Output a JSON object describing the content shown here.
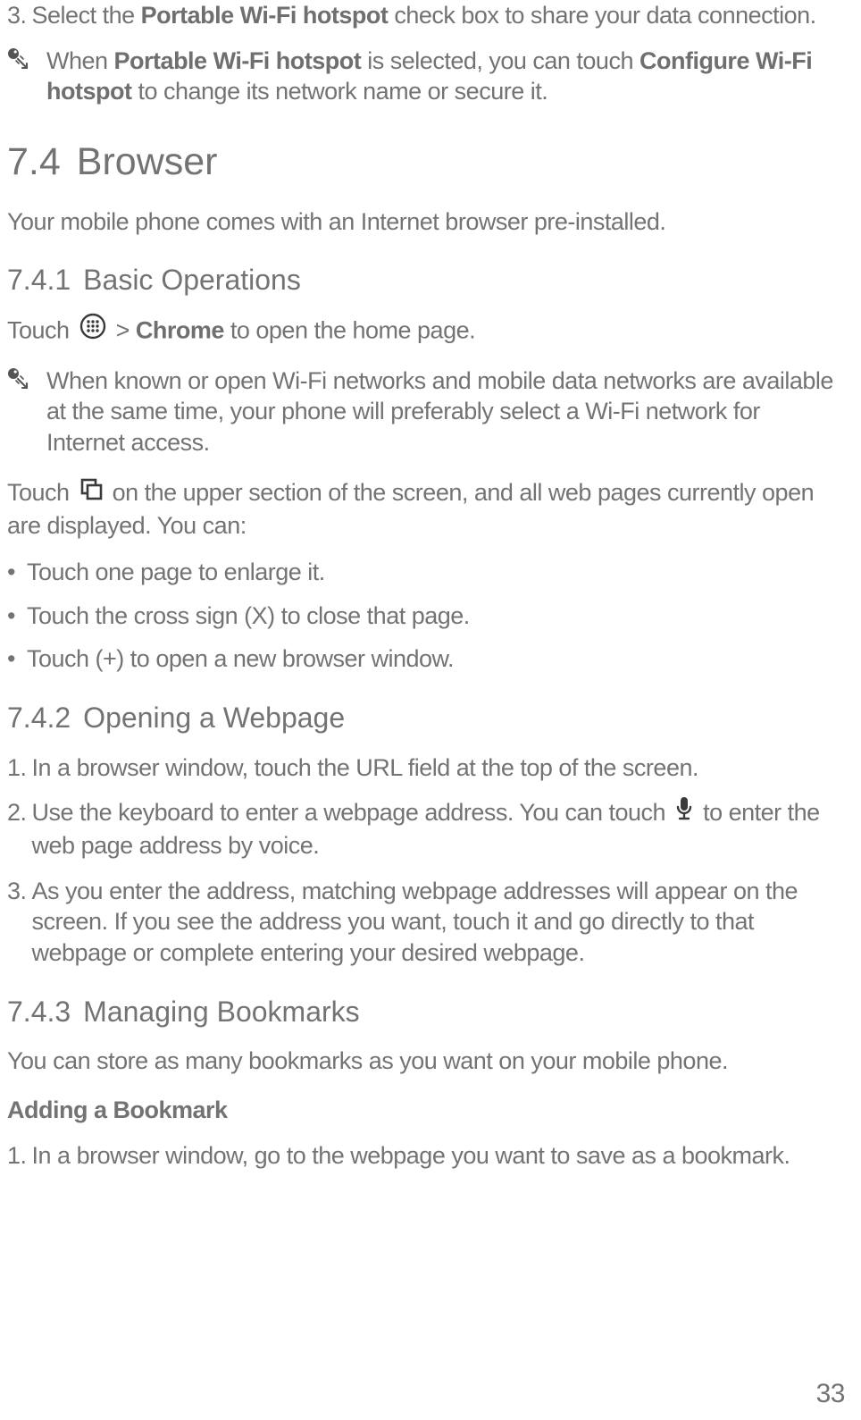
{
  "step3": {
    "num": "3.",
    "pre": "Select the ",
    "bold": "Portable Wi-Fi hotspot",
    "post": " check box to share your data connection."
  },
  "note1": {
    "t1": "When ",
    "b1": "Portable Wi-Fi hotspot",
    "t2": " is selected, you can touch ",
    "b2": "Configure Wi-Fi hotspot",
    "t3": " to change its network name or secure it."
  },
  "h1": {
    "num": "7.4",
    "title": "Browser"
  },
  "p_browser": "Your mobile phone comes with an Internet browser pre-installed.",
  "h2a": {
    "num": "7.4.1",
    "title": "Basic Operations"
  },
  "touch_chrome": {
    "pre": "Touch ",
    "mid": " > ",
    "bold": "Chrome",
    "post": " to open the home page."
  },
  "note2": "When known or open Wi-Fi networks and mobile data networks are available at the same time, your phone will preferably select a Wi-Fi network for Internet access.",
  "tabs_para": {
    "pre": "Touch ",
    "post": " on the upper section of the screen, and all web pages currently open are displayed. You can:"
  },
  "bullets": [
    "Touch one page to enlarge it.",
    "Touch the cross sign (X) to close that page.",
    "Touch (+) to open a new browser window."
  ],
  "h2b": {
    "num": "7.4.2",
    "title": "Opening a Webpage"
  },
  "open_steps": {
    "s1": {
      "num": "1.",
      "text": "In a browser window, touch the URL field at the top of the screen."
    },
    "s2": {
      "num": "2.",
      "pre": "Use the keyboard to enter a webpage address. You can touch ",
      "post": " to enter the web page address by voice."
    },
    "s3": {
      "num": "3.",
      "text": "As you enter the address, matching webpage addresses will appear on the screen. If you see the address you want, touch it and go directly to that webpage or complete entering your desired webpage."
    }
  },
  "h2c": {
    "num": "7.4.3",
    "title": "Managing Bookmarks"
  },
  "p_bookmarks": "You can store as many bookmarks as you want on your mobile phone.",
  "h3_add": "Adding a Bookmark",
  "add_steps": {
    "s1": {
      "num": "1.",
      "text": "In a browser window, go to the webpage you want to save as a bookmark."
    }
  },
  "page_number": "33",
  "bullet_marker": "•"
}
